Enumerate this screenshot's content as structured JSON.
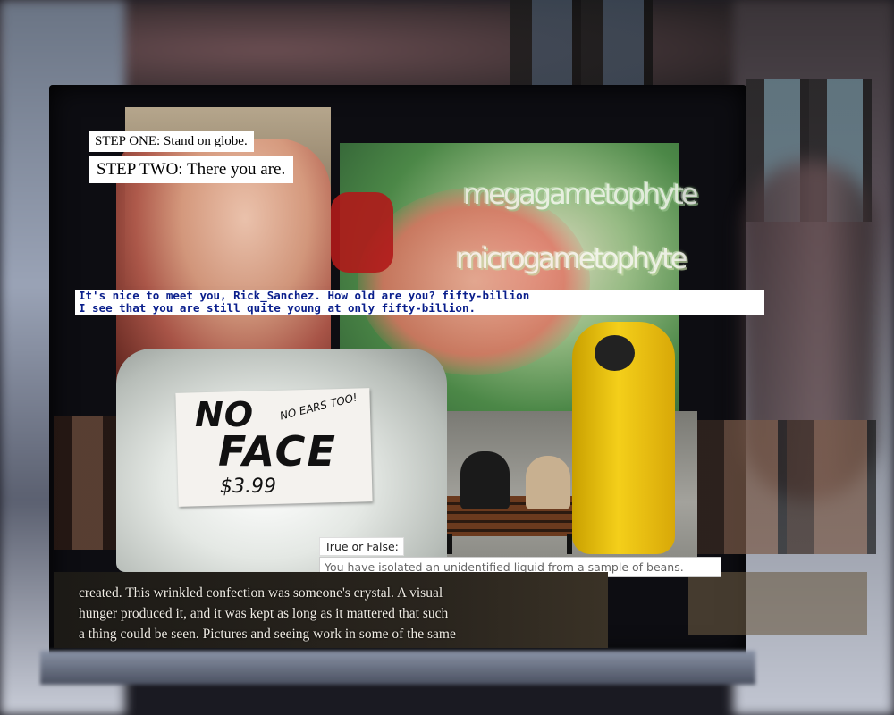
{
  "steps": {
    "one": "STEP ONE: Stand on globe.",
    "two": "STEP TWO: There you are."
  },
  "wordart": {
    "line1": "megagametophyte",
    "line2": "microgametophyte"
  },
  "chat": {
    "line1": "It's nice to meet you, Rick_Sanchez. How old are you? fifty-billion",
    "line2": "I see that you are still quite young at only fifty-billion."
  },
  "sign": {
    "no": "NO",
    "ears": "NO EARS TOO!",
    "face": "FACE",
    "price": "$3.99"
  },
  "quiz": {
    "label": "True or False:",
    "question": "You have isolated an unidentified liquid from a sample of beans."
  },
  "book": {
    "line1": "created. This wrinkled confection was someone's crystal. A visual",
    "line2": "hunger produced it, and it was kept as long as it mattered that such",
    "line3": "a thing could be seen. Pictures and seeing work in some of the same"
  },
  "colors": {
    "chat_text": "#0a1f8c",
    "hazmat_yellow": "#f4cf1a"
  }
}
